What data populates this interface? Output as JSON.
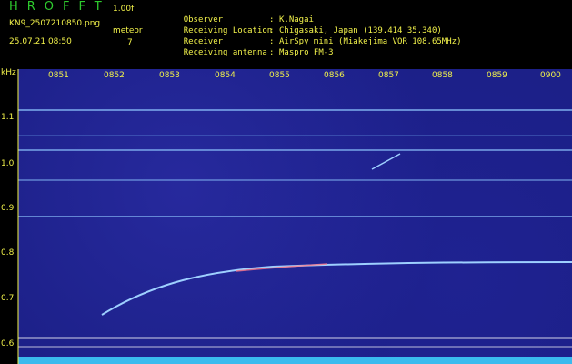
{
  "header": {
    "logo": "HROFFT",
    "version": "1.00f",
    "filename": "KN9_2507210850.png",
    "date": "25.07.21 08:50",
    "meteor_label": "meteor",
    "meteor_count": "7",
    "info": [
      {
        "key": "Observer",
        "value": "K.Nagai"
      },
      {
        "key": "Receiving Location",
        "value": "Chigasaki, Japan (139.414 35.340)"
      },
      {
        "key": "Receiver",
        "value": "AirSpy mini (Miakejima VOR 108.65MHz)"
      },
      {
        "key": "Receiving antenna",
        "value": "Maspro FM-3"
      }
    ],
    "separator": ":"
  },
  "axis": {
    "unit": "kHz",
    "x_ticks": [
      "0851",
      "0852",
      "0853",
      "0854",
      "0855",
      "0856",
      "0857",
      "0858",
      "0859",
      "0900"
    ],
    "y_ticks": [
      "1.1",
      "1.0",
      "0.9",
      "0.8",
      "0.7",
      "0.6"
    ]
  },
  "colors": {
    "background": "#1b1f86",
    "text": "#f2f24a",
    "logo": "#2ecc2e",
    "trace": "#9ed0ff"
  }
}
